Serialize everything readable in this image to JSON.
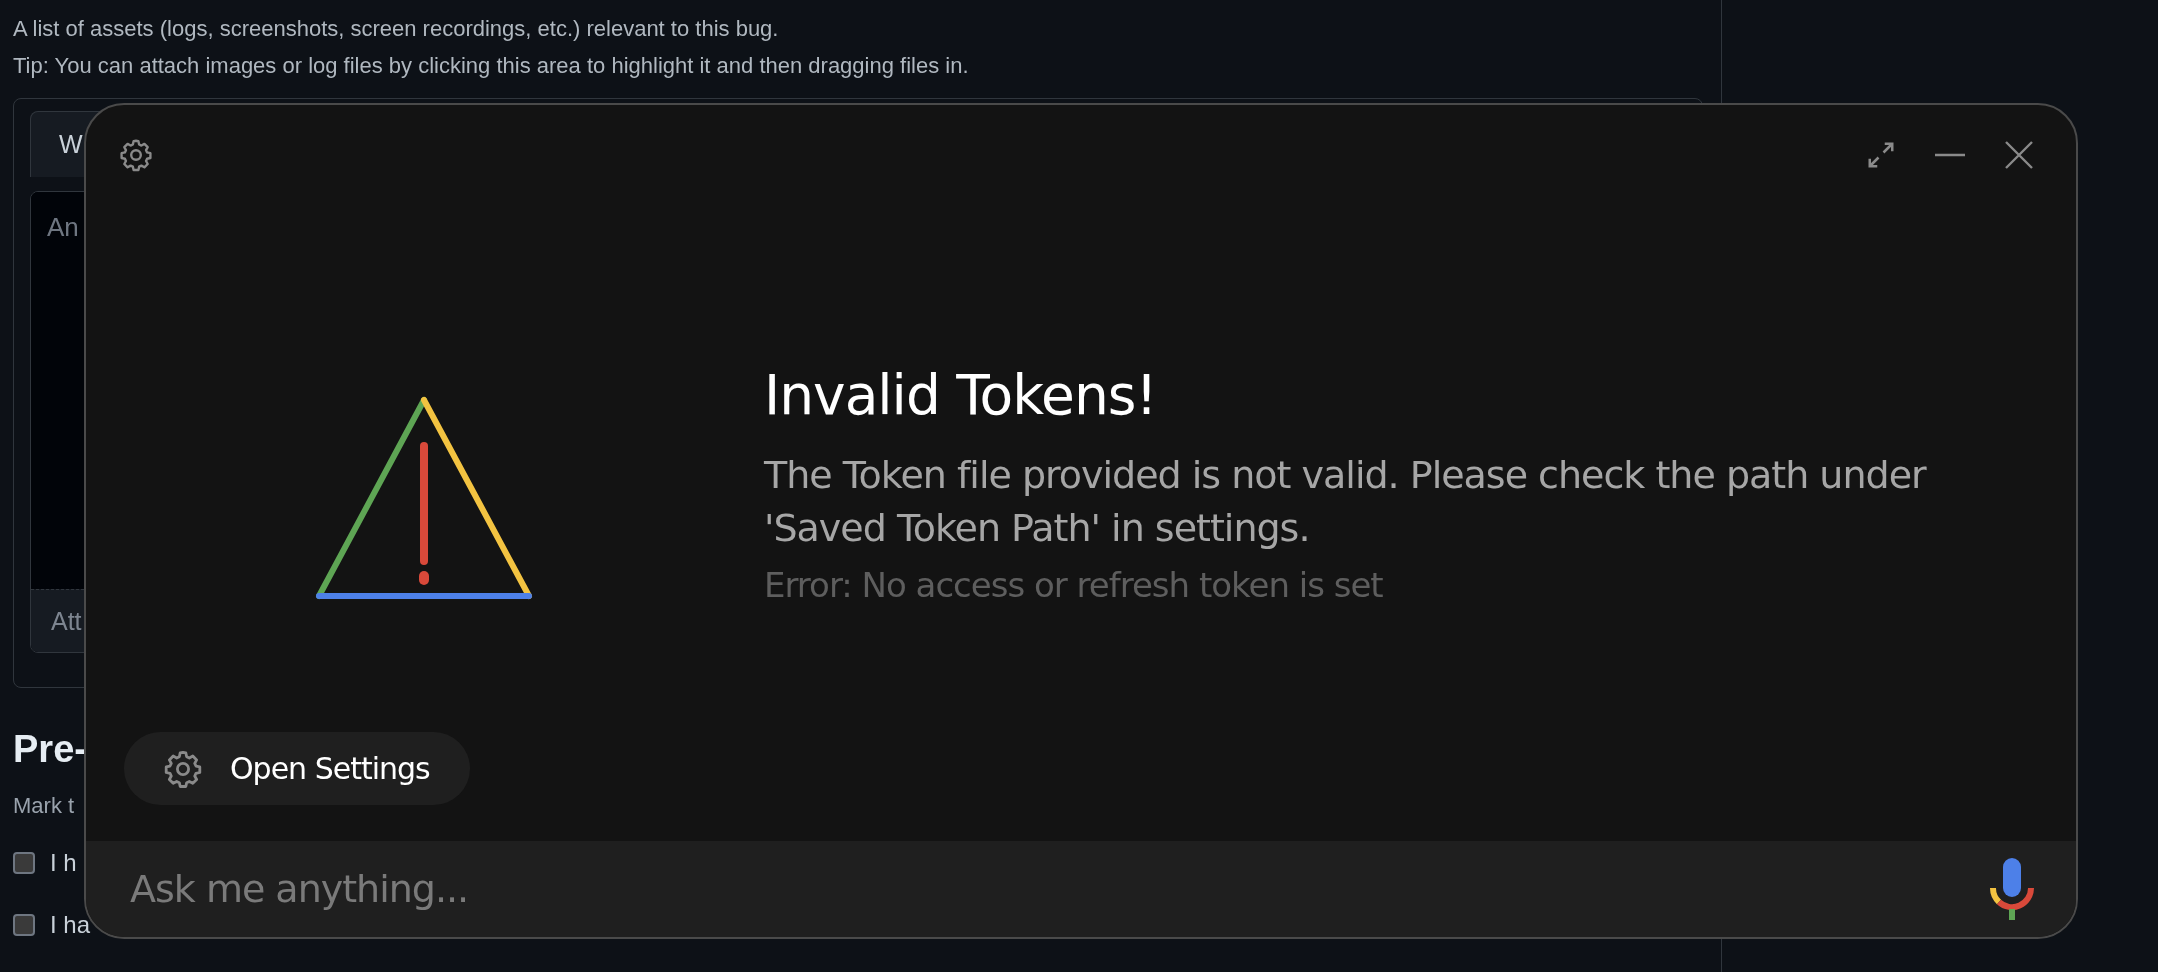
{
  "background_page": {
    "description_lines": [
      "A list of assets (logs, screenshots, screen recordings, etc.) relevant to this bug.",
      "Tip: You can attach images or log files by clicking this area to highlight it and then dragging files in."
    ],
    "attachments_card": {
      "tab": "W",
      "textarea": {
        "placeholder": "An"
      },
      "attach_bar": "Att"
    },
    "section_heading": "Pre-",
    "section_hint": "Mark t",
    "checklist": [
      {
        "label": "I h",
        "checked": false
      },
      {
        "label": "I ha",
        "checked": false
      }
    ]
  },
  "assistant_dialog": {
    "title": "Invalid Tokens!",
    "message": "The Token file provided is not valid. Please check the path under 'Saved Token Path' in settings.",
    "error": "Error: No access or refresh token is set",
    "button": "Open Settings",
    "input": {
      "placeholder": "Ask me anything..."
    }
  }
}
